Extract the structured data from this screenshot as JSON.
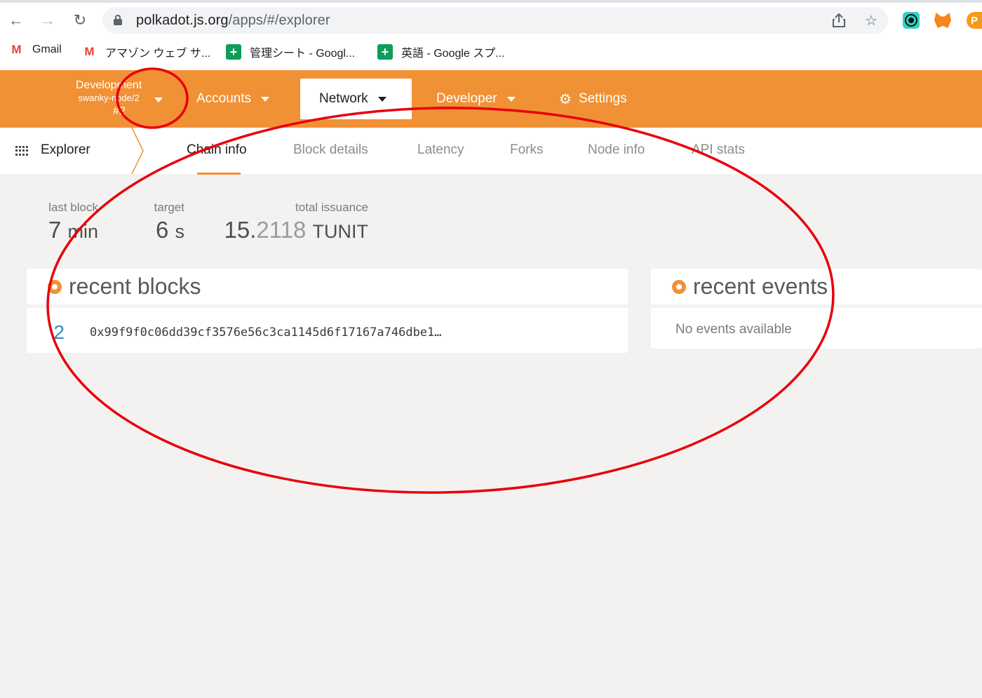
{
  "browser": {
    "url_host": "polkadot.js.org",
    "url_path": "/apps/#/explorer",
    "bookmarks": [
      {
        "label": "Gmail",
        "icon": "gmail-icon"
      },
      {
        "label": "アマゾン ウェブ サ...",
        "icon": "gmail-icon"
      },
      {
        "label": "管理シート - Googl...",
        "icon": "google-sheets-icon"
      },
      {
        "label": "英語 - Google スプ...",
        "icon": "google-sheets-icon"
      }
    ]
  },
  "header": {
    "chain_name": "Development",
    "node_name": "swanky-node/2",
    "block": "#2",
    "menu": {
      "accounts": "Accounts",
      "network": "Network",
      "developer": "Developer",
      "settings": "Settings"
    }
  },
  "subnav": {
    "title": "Explorer",
    "tabs": [
      "Chain info",
      "Block details",
      "Latency",
      "Forks",
      "Node info",
      "API stats"
    ],
    "active_tab": "Chain info"
  },
  "summary": {
    "last_block": {
      "label": "last block",
      "value": "7",
      "unit": "min"
    },
    "target": {
      "label": "target",
      "value": "6",
      "unit": "s"
    },
    "total_issuance": {
      "label": "total issuance",
      "int": "15.",
      "dec": "2118",
      "unit": "TUNIT"
    }
  },
  "recent_blocks": {
    "title": "recent blocks",
    "rows": [
      {
        "number": "2",
        "hash": "0x99f9f0c06dd39cf3576e56c3ca1145d6f17167a746dbe1…"
      }
    ]
  },
  "recent_events": {
    "title": "recent events",
    "empty_text": "No events available"
  },
  "colors": {
    "accent": "#f19135",
    "annotation": "#e8000b",
    "block_link": "#2d8fc0"
  }
}
